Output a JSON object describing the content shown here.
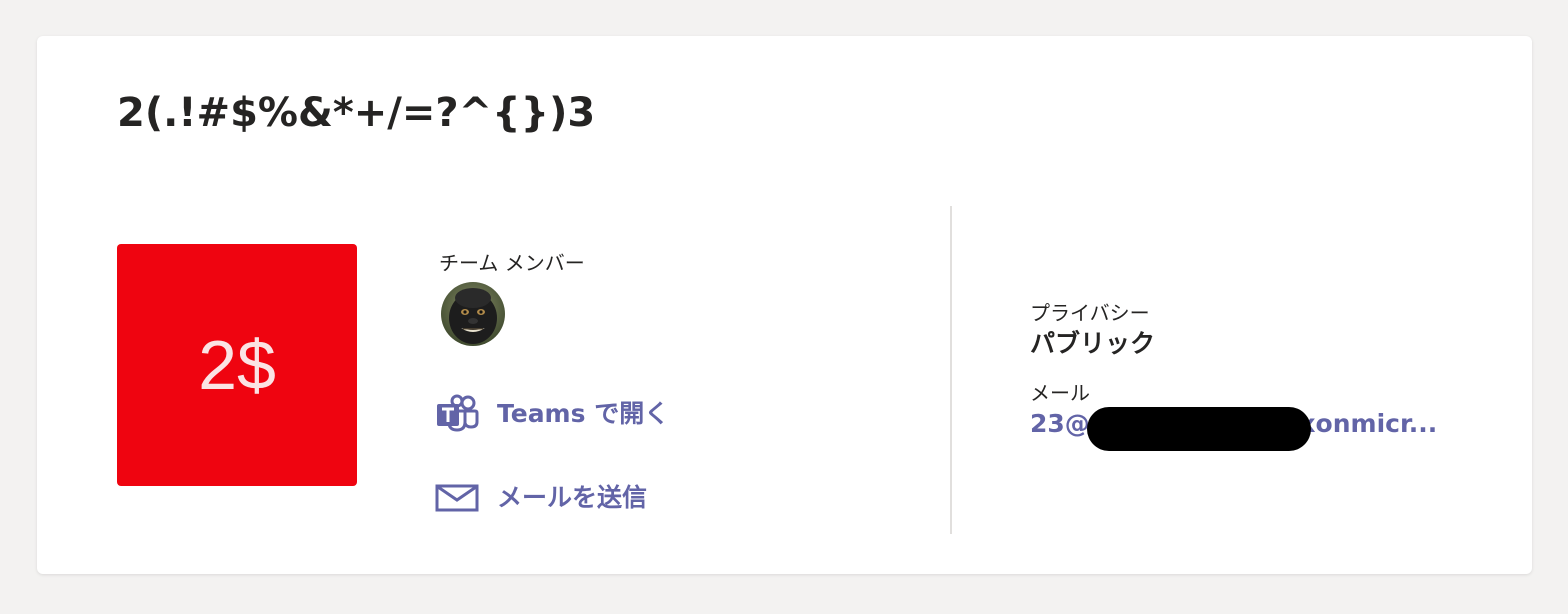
{
  "team": {
    "title": "2(.!#$%&*+/=?^{})3",
    "tile_text": "2$",
    "tile_color": "#ef0410"
  },
  "members": {
    "label": "チーム メンバー",
    "avatar_icon": "member-avatar-photo"
  },
  "actions": {
    "open_in_teams": {
      "label": "Teams で開く",
      "icon": "teams-icon"
    },
    "send_mail": {
      "label": "メールを送信",
      "icon": "mail-icon"
    }
  },
  "details": {
    "privacy_label": "プライバシー",
    "privacy_value": "パブリック",
    "email_label": "メール",
    "email_value": "23@xxxxxxxxxxxxxxonmicr..."
  },
  "colors": {
    "accent": "#6264a7",
    "background": "#f3f2f1",
    "card": "#ffffff"
  }
}
